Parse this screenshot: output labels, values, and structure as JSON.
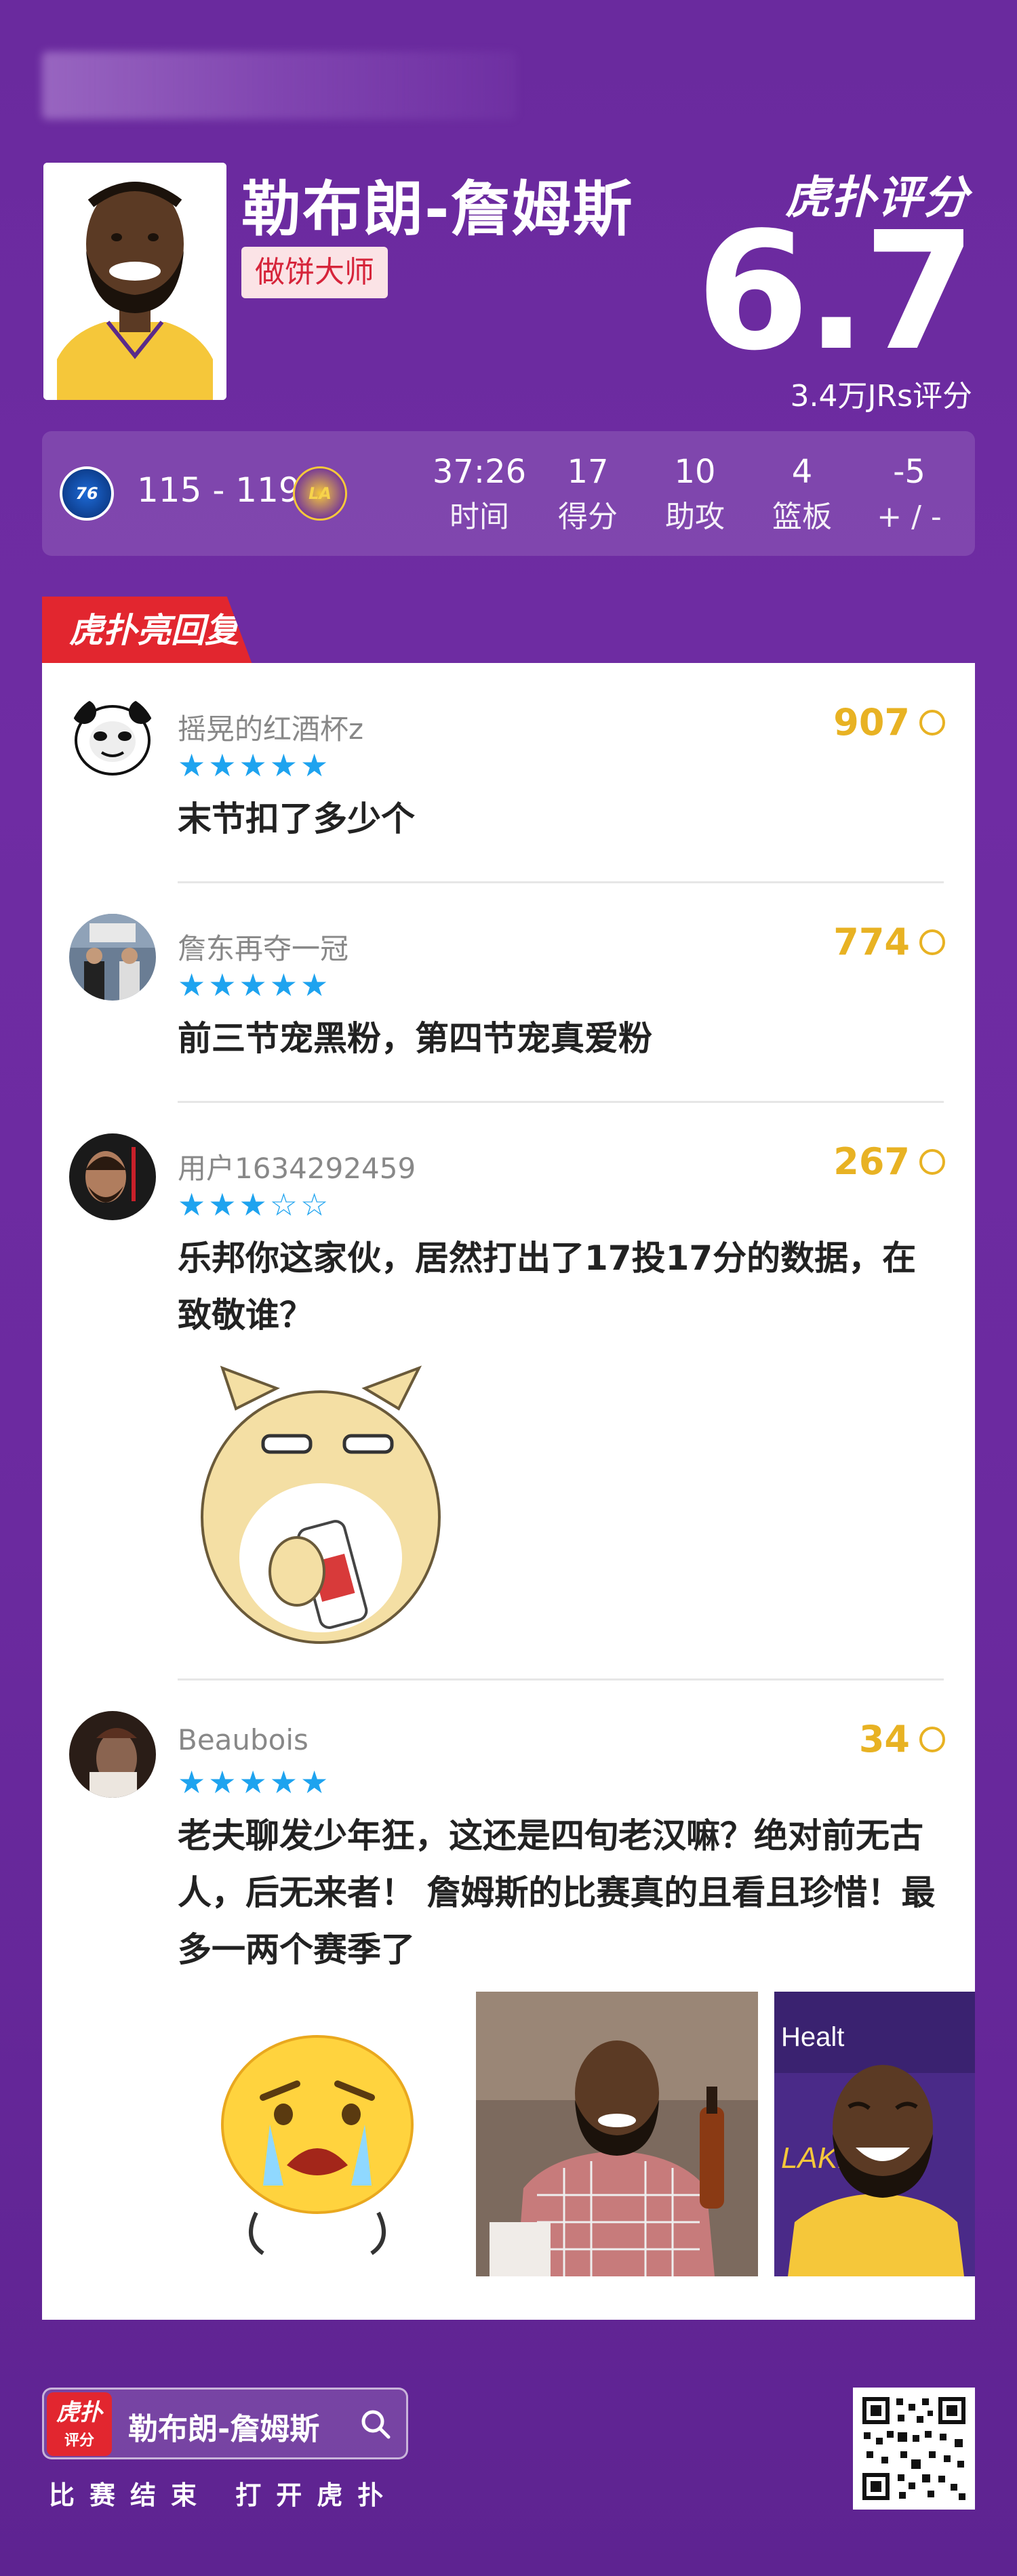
{
  "header": {
    "player_name": "勒布朗-詹姆斯",
    "nickname": "做饼大师",
    "brand": "虎扑评分",
    "score": "6.7",
    "rating_count": "3.4万JRs评分"
  },
  "game": {
    "score": "115 - 119",
    "stats": [
      {
        "value": "37:26",
        "label": "时间"
      },
      {
        "value": "17",
        "label": "得分"
      },
      {
        "value": "10",
        "label": "助攻"
      },
      {
        "value": "4",
        "label": "篮板"
      },
      {
        "value": "-5",
        "label": "+ / -"
      }
    ]
  },
  "section_tag": "虎扑亮回复",
  "comments": [
    {
      "user": "摇晃的红酒杯z",
      "likes": "907",
      "rating": 5,
      "stars": "★★★★★",
      "text": "末节扣了多少个"
    },
    {
      "user": "詹东再夺一冠",
      "likes": "774",
      "rating": 5,
      "stars": "★★★★★",
      "text": "前三节宠黑粉，第四节宠真爱粉"
    },
    {
      "user": "用户1634292459",
      "likes": "267",
      "rating": 3,
      "stars": "★★★☆☆",
      "text": "乐邦你这家伙，居然打出了17投17分的数据，在致敬谁？"
    },
    {
      "user": "Beaubois",
      "likes": "34",
      "rating": 5,
      "stars": "★★★★★",
      "text": "老夫聊发少年狂，这还是四旬老汉嘛？绝对前无古人，后无来者！ 詹姆斯的比赛真的且看且珍惜！最多一两个赛季了"
    }
  ],
  "footer": {
    "logo_text": "虎扑",
    "logo_sub": "评分",
    "search_name": "勒布朗-詹姆斯",
    "caption": "比赛结束 打开虎扑"
  },
  "colors": {
    "accent_red": "#e2262f",
    "likes_gold": "#e8b223",
    "star_blue": "#1ea3ef"
  }
}
